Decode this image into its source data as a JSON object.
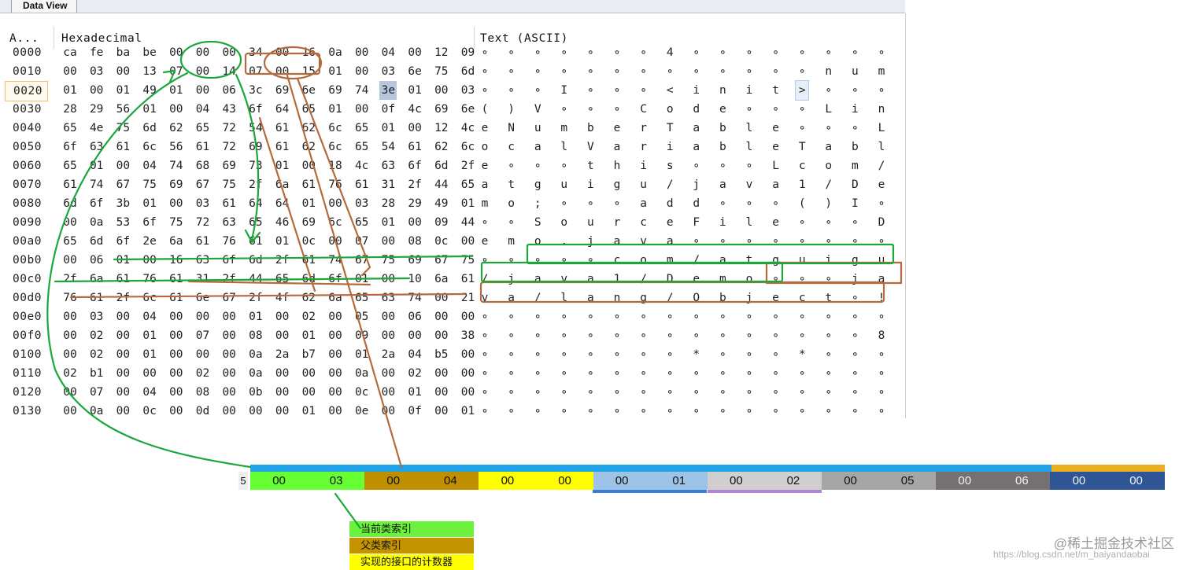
{
  "tab": {
    "label": "Data View"
  },
  "columns": {
    "address": "A...",
    "hex": "Hexadecimal",
    "text": "Text (ASCII)"
  },
  "rows": [
    {
      "addr": "0000",
      "hex": [
        "ca",
        "fe",
        "ba",
        "be",
        "00",
        "00",
        "00",
        "34",
        "00",
        "16",
        "0a",
        "00",
        "04",
        "00",
        "12",
        "09"
      ],
      "ascii": [
        "∘",
        "∘",
        "∘",
        "∘",
        "∘",
        "∘",
        "∘",
        "4",
        "∘",
        "∘",
        "∘",
        "∘",
        "∘",
        "∘",
        "∘",
        "∘"
      ]
    },
    {
      "addr": "0010",
      "hex": [
        "00",
        "03",
        "00",
        "13",
        "07",
        "00",
        "14",
        "07",
        "00",
        "15",
        "01",
        "00",
        "03",
        "6e",
        "75",
        "6d"
      ],
      "ascii": [
        "∘",
        "∘",
        "∘",
        "∘",
        "∘",
        "∘",
        "∘",
        "∘",
        "∘",
        "∘",
        "∘",
        "∘",
        "∘",
        "n",
        "u",
        "m"
      ]
    },
    {
      "addr": "0020",
      "hex": [
        "01",
        "00",
        "01",
        "49",
        "01",
        "00",
        "06",
        "3c",
        "69",
        "6e",
        "69",
        "74",
        "3e",
        "01",
        "00",
        "03"
      ],
      "ascii": [
        "∘",
        "∘",
        "∘",
        "I",
        "∘",
        "∘",
        "∘",
        "<",
        "i",
        "n",
        "i",
        "t",
        ">",
        "∘",
        "∘",
        "∘"
      ]
    },
    {
      "addr": "0030",
      "hex": [
        "28",
        "29",
        "56",
        "01",
        "00",
        "04",
        "43",
        "6f",
        "64",
        "65",
        "01",
        "00",
        "0f",
        "4c",
        "69",
        "6e"
      ],
      "ascii": [
        "(",
        ")",
        "V",
        "∘",
        "∘",
        "∘",
        "C",
        "o",
        "d",
        "e",
        "∘",
        "∘",
        "∘",
        "L",
        "i",
        "n"
      ]
    },
    {
      "addr": "0040",
      "hex": [
        "65",
        "4e",
        "75",
        "6d",
        "62",
        "65",
        "72",
        "54",
        "61",
        "62",
        "6c",
        "65",
        "01",
        "00",
        "12",
        "4c"
      ],
      "ascii": [
        "e",
        "N",
        "u",
        "m",
        "b",
        "e",
        "r",
        "T",
        "a",
        "b",
        "l",
        "e",
        "∘",
        "∘",
        "∘",
        "L"
      ]
    },
    {
      "addr": "0050",
      "hex": [
        "6f",
        "63",
        "61",
        "6c",
        "56",
        "61",
        "72",
        "69",
        "61",
        "62",
        "6c",
        "65",
        "54",
        "61",
        "62",
        "6c"
      ],
      "ascii": [
        "o",
        "c",
        "a",
        "l",
        "V",
        "a",
        "r",
        "i",
        "a",
        "b",
        "l",
        "e",
        "T",
        "a",
        "b",
        "l"
      ]
    },
    {
      "addr": "0060",
      "hex": [
        "65",
        "01",
        "00",
        "04",
        "74",
        "68",
        "69",
        "73",
        "01",
        "00",
        "18",
        "4c",
        "63",
        "6f",
        "6d",
        "2f"
      ],
      "ascii": [
        "e",
        "∘",
        "∘",
        "∘",
        "t",
        "h",
        "i",
        "s",
        "∘",
        "∘",
        "∘",
        "L",
        "c",
        "o",
        "m",
        "/"
      ]
    },
    {
      "addr": "0070",
      "hex": [
        "61",
        "74",
        "67",
        "75",
        "69",
        "67",
        "75",
        "2f",
        "6a",
        "61",
        "76",
        "61",
        "31",
        "2f",
        "44",
        "65"
      ],
      "ascii": [
        "a",
        "t",
        "g",
        "u",
        "i",
        "g",
        "u",
        "/",
        "j",
        "a",
        "v",
        "a",
        "1",
        "/",
        "D",
        "e"
      ]
    },
    {
      "addr": "0080",
      "hex": [
        "6d",
        "6f",
        "3b",
        "01",
        "00",
        "03",
        "61",
        "64",
        "64",
        "01",
        "00",
        "03",
        "28",
        "29",
        "49",
        "01"
      ],
      "ascii": [
        "m",
        "o",
        ";",
        "∘",
        "∘",
        "∘",
        "a",
        "d",
        "d",
        "∘",
        "∘",
        "∘",
        "(",
        ")",
        "I",
        "∘"
      ]
    },
    {
      "addr": "0090",
      "hex": [
        "00",
        "0a",
        "53",
        "6f",
        "75",
        "72",
        "63",
        "65",
        "46",
        "69",
        "6c",
        "65",
        "01",
        "00",
        "09",
        "44"
      ],
      "ascii": [
        "∘",
        "∘",
        "S",
        "o",
        "u",
        "r",
        "c",
        "e",
        "F",
        "i",
        "l",
        "e",
        "∘",
        "∘",
        "∘",
        "D"
      ]
    },
    {
      "addr": "00a0",
      "hex": [
        "65",
        "6d",
        "6f",
        "2e",
        "6a",
        "61",
        "76",
        "61",
        "01",
        "0c",
        "00",
        "07",
        "00",
        "08",
        "0c",
        "00",
        "05"
      ],
      "ascii": [
        "e",
        "m",
        "o",
        ".",
        "j",
        "a",
        "v",
        "a",
        "∘",
        "∘",
        "∘",
        "∘",
        "∘",
        "∘",
        "∘",
        "∘"
      ]
    },
    {
      "addr": "00b0",
      "hex": [
        "00",
        "06",
        "01",
        "00",
        "16",
        "63",
        "6f",
        "6d",
        "2f",
        "61",
        "74",
        "67",
        "75",
        "69",
        "67",
        "75"
      ],
      "ascii": [
        "∘",
        "∘",
        "∘",
        "∘",
        "∘",
        "c",
        "o",
        "m",
        "/",
        "a",
        "t",
        "g",
        "u",
        "i",
        "g",
        "u"
      ]
    },
    {
      "addr": "00c0",
      "hex": [
        "2f",
        "6a",
        "61",
        "76",
        "61",
        "31",
        "2f",
        "44",
        "65",
        "6d",
        "6f",
        "01",
        "00",
        "10",
        "6a",
        "61"
      ],
      "ascii": [
        "/",
        "j",
        "a",
        "v",
        "a",
        "1",
        "/",
        "D",
        "e",
        "m",
        "o",
        "∘",
        "∘",
        "∘",
        "j",
        "a"
      ]
    },
    {
      "addr": "00d0",
      "hex": [
        "76",
        "61",
        "2f",
        "6c",
        "61",
        "6e",
        "67",
        "2f",
        "4f",
        "62",
        "6a",
        "65",
        "63",
        "74",
        "00",
        "21"
      ],
      "ascii": [
        "v",
        "a",
        "/",
        "l",
        "a",
        "n",
        "g",
        "/",
        "O",
        "b",
        "j",
        "e",
        "c",
        "t",
        "∘",
        "!"
      ]
    },
    {
      "addr": "00e0",
      "hex": [
        "00",
        "03",
        "00",
        "04",
        "00",
        "00",
        "00",
        "01",
        "00",
        "02",
        "00",
        "05",
        "00",
        "06",
        "00",
        "00"
      ],
      "ascii": [
        "∘",
        "∘",
        "∘",
        "∘",
        "∘",
        "∘",
        "∘",
        "∘",
        "∘",
        "∘",
        "∘",
        "∘",
        "∘",
        "∘",
        "∘",
        "∘"
      ]
    },
    {
      "addr": "00f0",
      "hex": [
        "00",
        "02",
        "00",
        "01",
        "00",
        "07",
        "00",
        "08",
        "00",
        "01",
        "00",
        "09",
        "00",
        "00",
        "00",
        "38"
      ],
      "ascii": [
        "∘",
        "∘",
        "∘",
        "∘",
        "∘",
        "∘",
        "∘",
        "∘",
        "∘",
        "∘",
        "∘",
        "∘",
        "∘",
        "∘",
        "∘",
        "8"
      ]
    },
    {
      "addr": "0100",
      "hex": [
        "00",
        "02",
        "00",
        "01",
        "00",
        "00",
        "00",
        "0a",
        "2a",
        "b7",
        "00",
        "01",
        "2a",
        "04",
        "b5",
        "00"
      ],
      "ascii": [
        "∘",
        "∘",
        "∘",
        "∘",
        "∘",
        "∘",
        "∘",
        "∘",
        "*",
        "∘",
        "∘",
        "∘",
        "*",
        "∘",
        "∘",
        "∘"
      ]
    },
    {
      "addr": "0110",
      "hex": [
        "02",
        "b1",
        "00",
        "00",
        "00",
        "02",
        "00",
        "0a",
        "00",
        "00",
        "00",
        "0a",
        "00",
        "02",
        "00",
        "00"
      ],
      "ascii": [
        "∘",
        "∘",
        "∘",
        "∘",
        "∘",
        "∘",
        "∘",
        "∘",
        "∘",
        "∘",
        "∘",
        "∘",
        "∘",
        "∘",
        "∘",
        "∘"
      ]
    },
    {
      "addr": "0120",
      "hex": [
        "00",
        "07",
        "00",
        "04",
        "00",
        "08",
        "00",
        "0b",
        "00",
        "00",
        "00",
        "0c",
        "00",
        "01",
        "00",
        "00"
      ],
      "ascii": [
        "∘",
        "∘",
        "∘",
        "∘",
        "∘",
        "∘",
        "∘",
        "∘",
        "∘",
        "∘",
        "∘",
        "∘",
        "∘",
        "∘",
        "∘",
        "∘"
      ]
    },
    {
      "addr": "0130",
      "hex": [
        "00",
        "0a",
        "00",
        "0c",
        "00",
        "0d",
        "00",
        "00",
        "00",
        "01",
        "00",
        "0e",
        "00",
        "0f",
        "00",
        "01"
      ],
      "ascii": [
        "∘",
        "∘",
        "∘",
        "∘",
        "∘",
        "∘",
        "∘",
        "∘",
        "∘",
        "∘",
        "∘",
        "∘",
        "∘",
        "∘",
        "∘",
        "∘"
      ]
    }
  ],
  "strip": {
    "row_label": "5",
    "cells": [
      "00",
      "03",
      "00",
      "04",
      "00",
      "00",
      "00",
      "01",
      "00",
      "02",
      "00",
      "05",
      "00",
      "06",
      "00",
      "00"
    ],
    "top_fragments": [
      "00",
      "21"
    ]
  },
  "legend": [
    "当前类索引",
    "父类索引",
    "实现的接口的计数器"
  ],
  "watermark": "@稀土掘金技术社区",
  "watermark_url": "https://blog.csdn.net/m_baiyandaobai"
}
